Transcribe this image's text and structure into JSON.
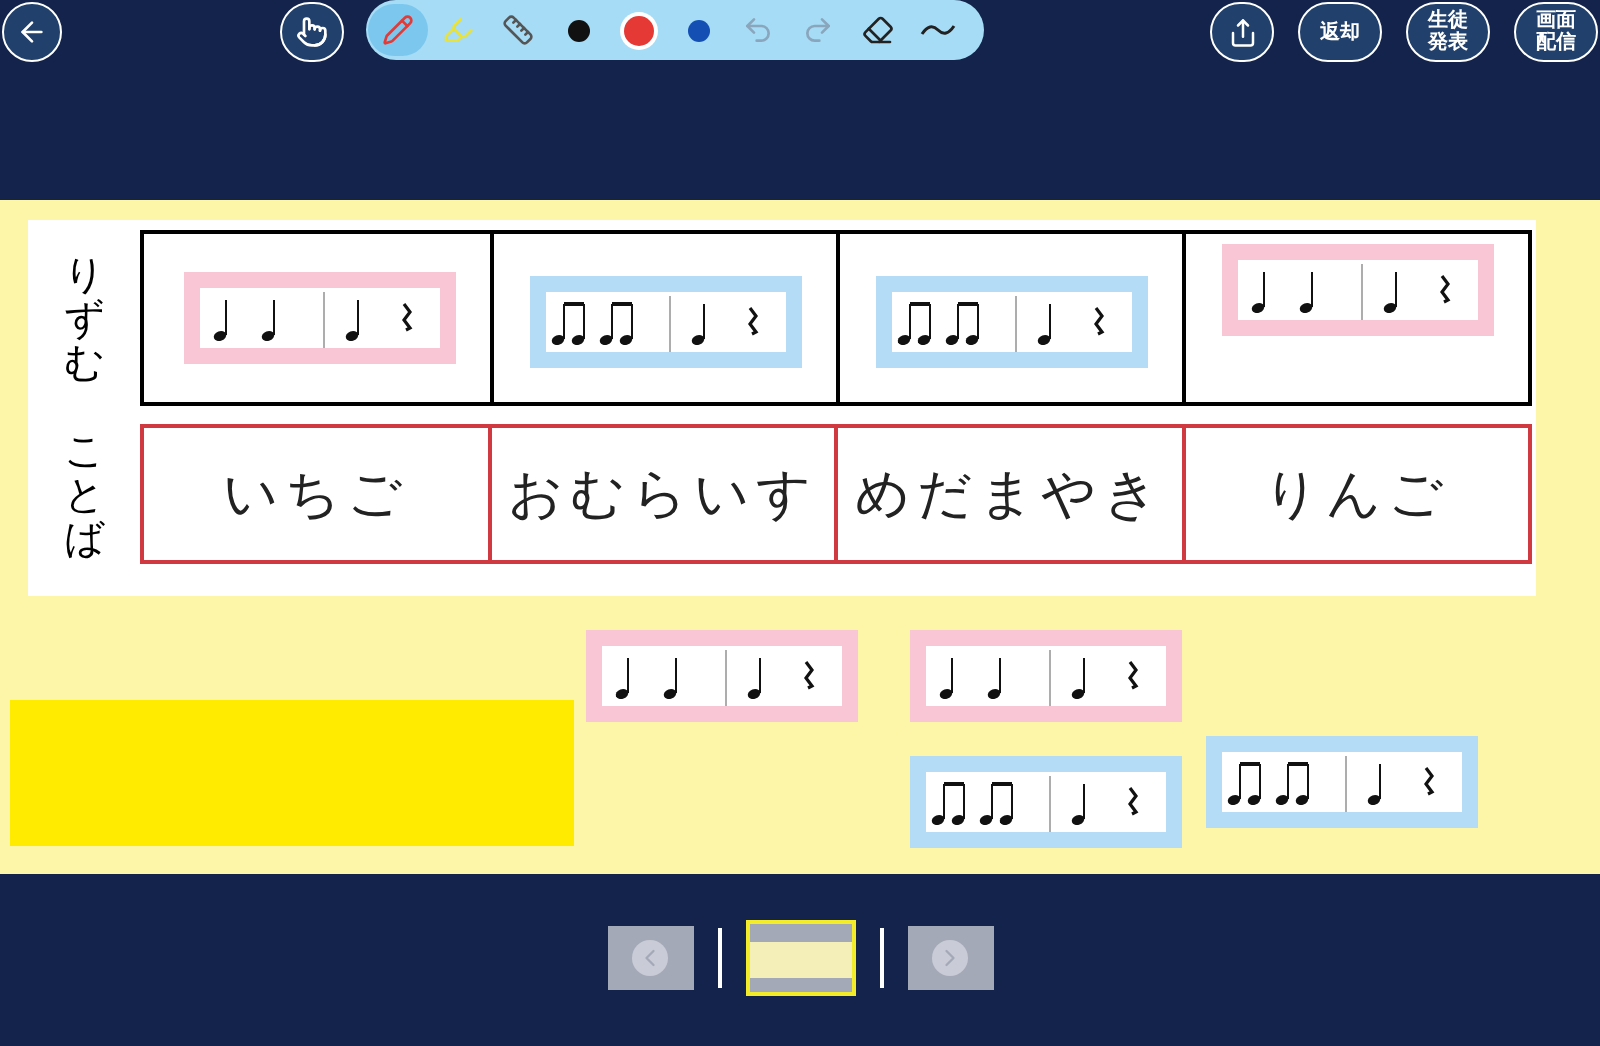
{
  "toolbar": {
    "hand": {
      "selected": false
    },
    "tools": [
      {
        "kind": "pen",
        "selected": true
      },
      {
        "kind": "highlighter",
        "selected": false
      },
      {
        "kind": "ruler",
        "selected": false
      }
    ],
    "colors": [
      {
        "color": "#111111",
        "selected": false
      },
      {
        "color": "#e53935",
        "selected": true
      },
      {
        "color": "#1450b4",
        "selected": false
      }
    ],
    "history": [
      {
        "kind": "undo",
        "disabled": true
      },
      {
        "kind": "redo",
        "disabled": true
      }
    ],
    "extras": [
      {
        "kind": "eraser",
        "selected": false
      },
      {
        "kind": "line-style",
        "selected": false
      }
    ],
    "actions": [
      {
        "kind": "share"
      },
      {
        "kind": "text",
        "lines": [
          "返却"
        ]
      },
      {
        "kind": "text",
        "lines": [
          "生徒",
          "発表"
        ]
      },
      {
        "kind": "text",
        "lines": [
          "画面",
          "配信"
        ]
      }
    ]
  },
  "board": {
    "rows": [
      {
        "kind": "rhythm",
        "label": "りずむ",
        "cells": [
          {
            "kind": "quarters",
            "color": "#f9c6d6"
          },
          {
            "kind": "eighths",
            "color": "#b5dcf7"
          },
          {
            "kind": "eighths",
            "color": "#b5dcf7"
          },
          {
            "kind": "quarters",
            "color": "#f9c6d6"
          }
        ]
      },
      {
        "kind": "words",
        "label": "ことば",
        "cells": [
          "いちご",
          "おむらいす",
          "めだまやき",
          "りんご"
        ]
      }
    ],
    "loose_cards": [
      {
        "kind": "quarters",
        "color": "#f9c6d6"
      },
      {
        "kind": "quarters",
        "color": "#f9c6d6"
      },
      {
        "kind": "eighths",
        "color": "#b5dcf7"
      },
      {
        "kind": "eighths",
        "color": "#b5dcf7"
      }
    ],
    "sticky_note": {
      "color": "#ffeb00"
    }
  },
  "pager": {
    "pages": [
      {
        "selected": true
      }
    ]
  }
}
